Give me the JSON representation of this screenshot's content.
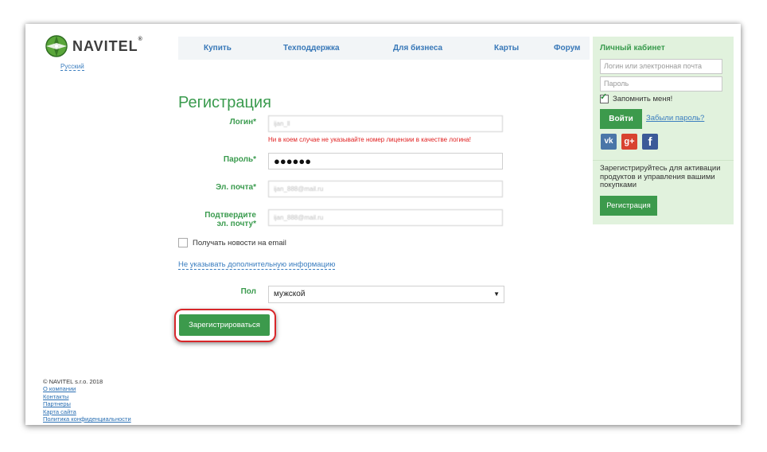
{
  "brand": {
    "logo_text": "NAVITEL",
    "trademark": "®",
    "language_link": "Русский"
  },
  "nav": {
    "items": [
      "Купить",
      "Техподдержка",
      "Для бизнеса",
      "Карты",
      "Форум"
    ]
  },
  "form": {
    "title": "Регистрация",
    "login_label": "Логин*",
    "login_value": "ijan_ll",
    "login_hint": "Ни в коем случае не указывайте номер лицензии в качестве логина!",
    "password_label": "Пароль*",
    "password_value": "●●●●●●",
    "email_label": "Эл. почта*",
    "email_value": "ijan_888@mail.ru",
    "confirm_label_line1": "Подтвердите",
    "confirm_label_line2": "эл. почту*",
    "confirm_value": "ijan_888@mail.ru",
    "newsletter_label": "Получать новости на email",
    "skip_info_link": "Не указывать дополнительную информацию",
    "gender_label": "Пол",
    "gender_value": "мужской",
    "submit_label": "Зарегистрироваться"
  },
  "account_panel": {
    "title": "Личный кабинет",
    "login_placeholder": "Логин или электронная почта",
    "password_placeholder": "Пароль",
    "remember_label": "Запомнить меня!",
    "remember_checked": true,
    "login_button": "Войти",
    "forgot_link": "Забыли пароль?",
    "social": {
      "vk": "vk",
      "google": "g+",
      "facebook": "f"
    },
    "register_text": "Зарегистрируйтесь для активации продуктов и управления вашими покупками",
    "register_button": "Регистрация"
  },
  "footer": {
    "copyright": "© NAVITEL s.r.o. 2018",
    "links": [
      "О компании",
      "Контакты",
      "Партнеры",
      "Карта сайта",
      "Политика конфиденциальности"
    ]
  },
  "colors": {
    "green": "#3c9a4c",
    "link": "#3a7dbf",
    "panel_bg": "#e1f2dd",
    "error": "#e02020",
    "highlight": "#d8262a"
  }
}
